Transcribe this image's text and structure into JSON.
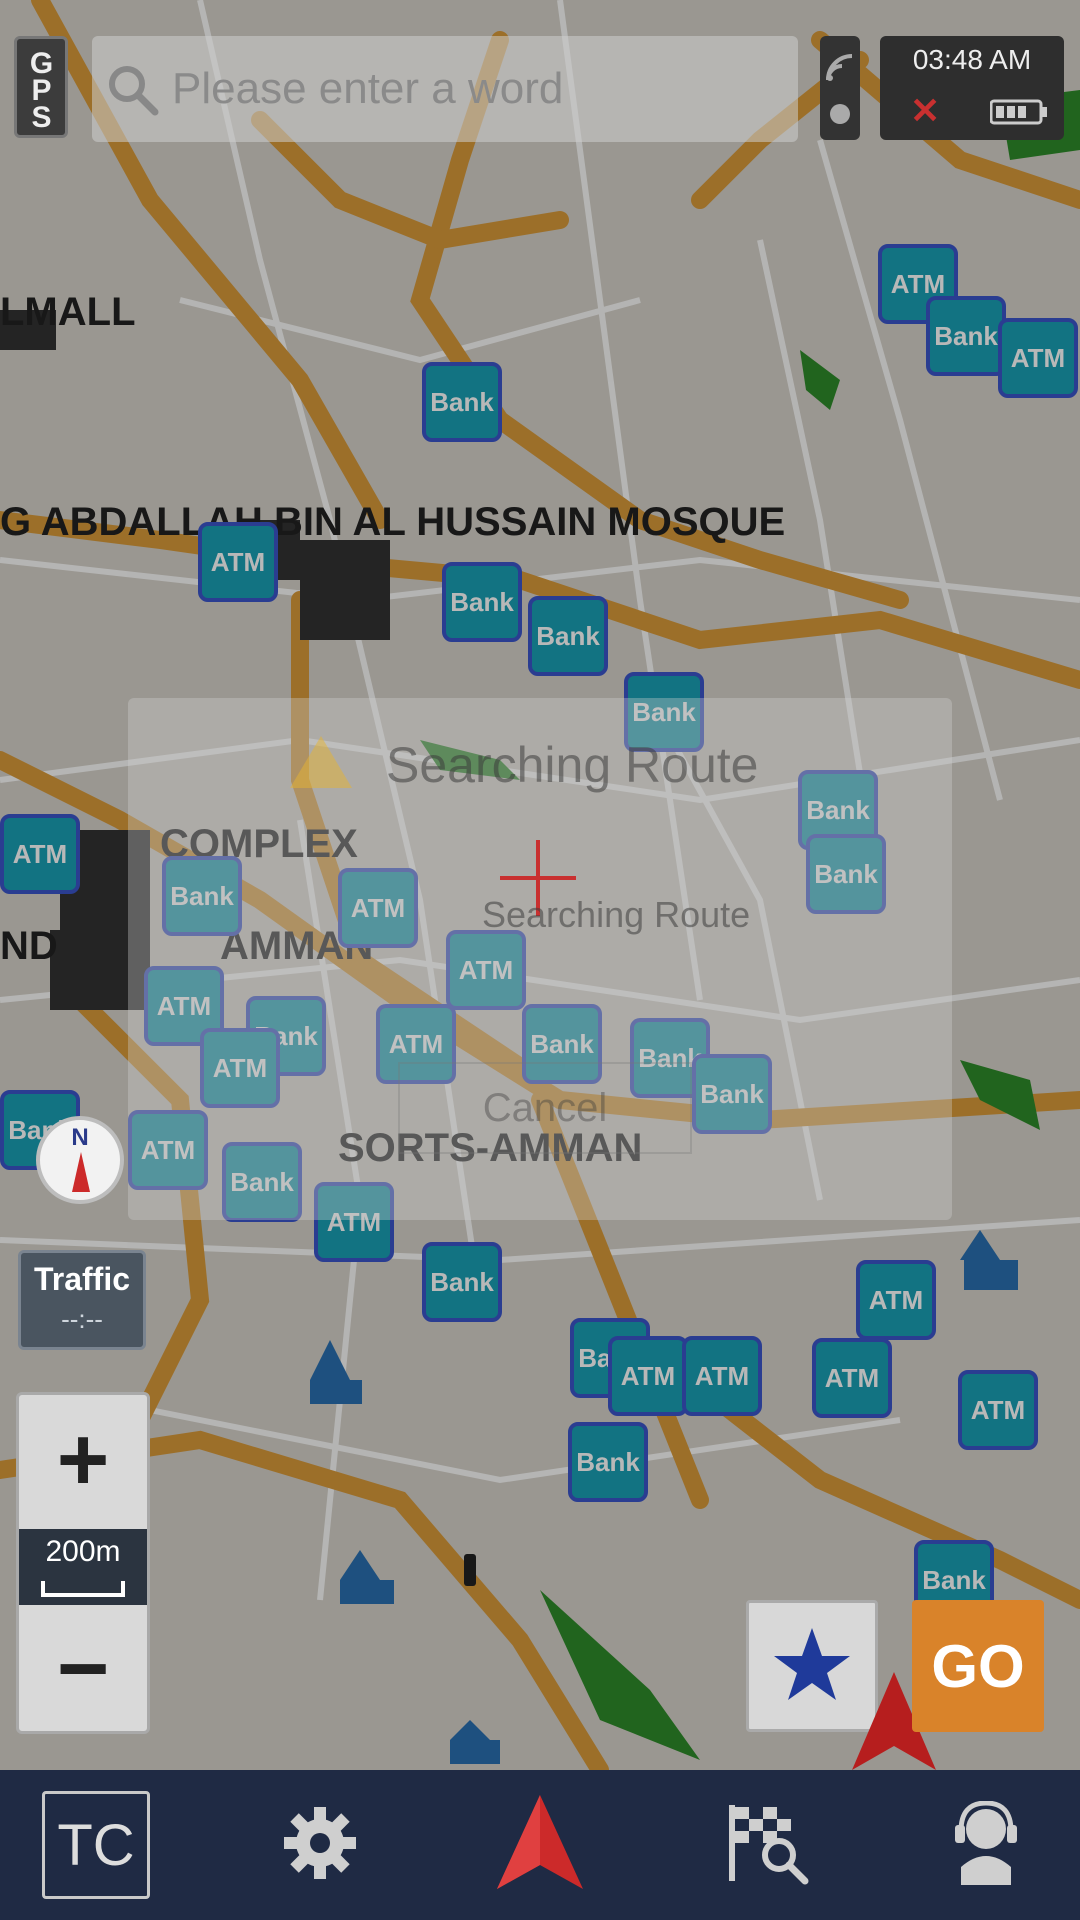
{
  "status": {
    "gps_label": "GPS",
    "time": "03:48 AM",
    "close_glyph": "✕"
  },
  "search": {
    "placeholder": "Please enter a word"
  },
  "map": {
    "labels": [
      "LMALL",
      "G ABDALLAH BIN AL HUSSAIN MOSQUE",
      "COMPLEX",
      "ND",
      "AMMAN",
      "SORTS-AMMAN"
    ],
    "poi_atm": "ATM",
    "poi_bank": "Bank"
  },
  "dialog": {
    "title": "Searching Route",
    "message": "Searching Route",
    "cancel_label": "Cancel"
  },
  "compass": {
    "north_label": "N"
  },
  "traffic": {
    "label": "Traffic",
    "value": "--:--"
  },
  "zoom": {
    "in_glyph": "+",
    "scale": "200m",
    "out_glyph": "−"
  },
  "actions": {
    "go_label": "GO"
  },
  "bottom_nav": {
    "tc_label": "TC"
  },
  "colors": {
    "road": "#d99a3a",
    "poi_fill": "#1aa0b4",
    "poi_border": "#3b55c9",
    "go": "#d9832a",
    "nav_bar": "#1f2a44",
    "arrow": "#cc2a2a"
  }
}
